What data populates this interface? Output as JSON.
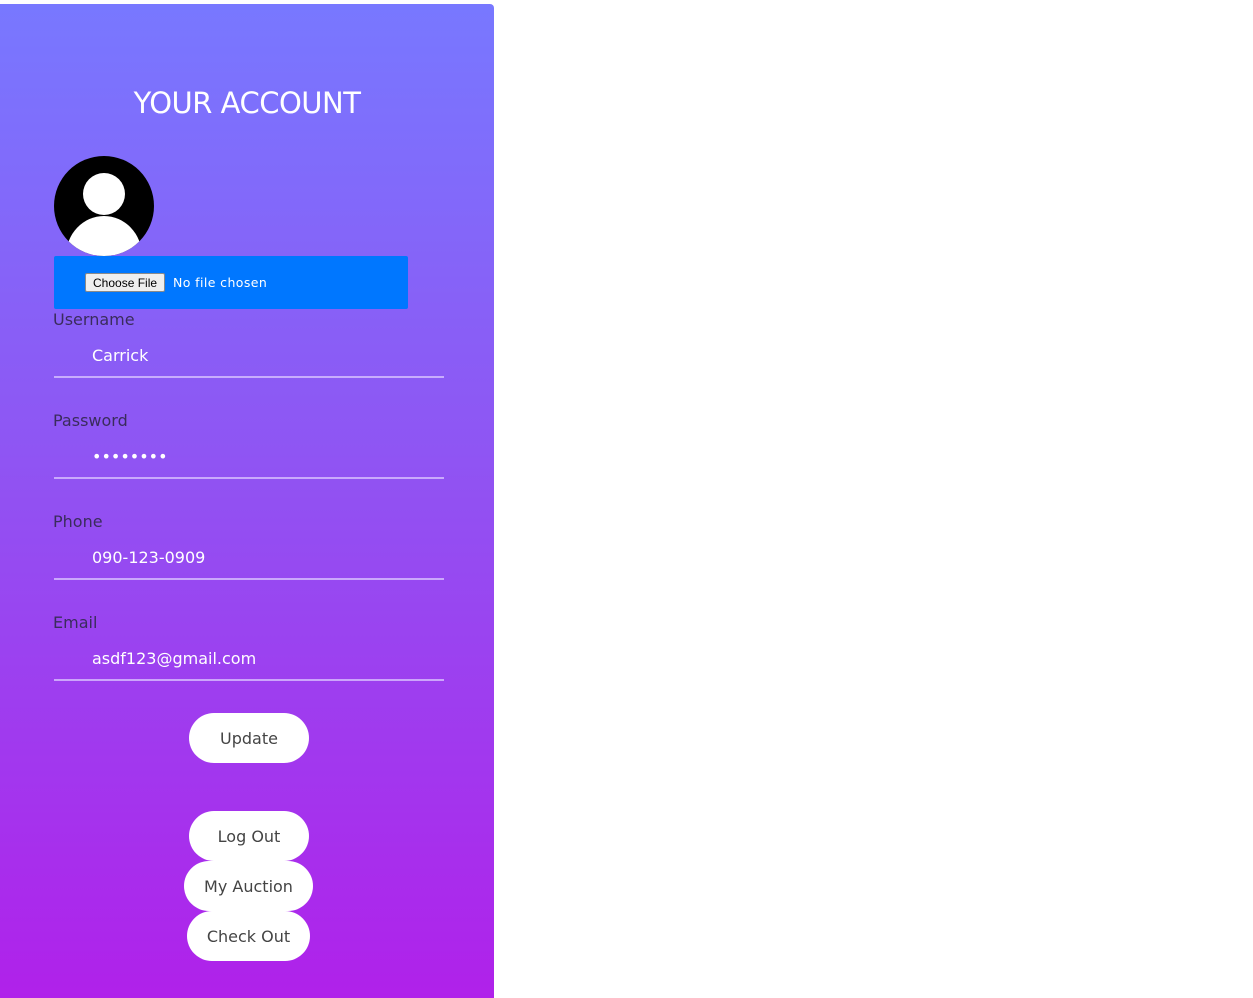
{
  "account": {
    "title": "YOUR ACCOUNT"
  },
  "upload": {
    "button_label": "Choose File",
    "status": "No file chosen"
  },
  "fields": {
    "username": {
      "label": "Username",
      "value": "Carrick"
    },
    "password": {
      "label": "Password",
      "value": "••••••••"
    },
    "phone": {
      "label": "Phone",
      "value": "090-123-0909"
    },
    "email": {
      "label": "Email",
      "value": "asdf123@gmail.com"
    }
  },
  "actions": {
    "update": "Update",
    "logout": "Log Out",
    "my_auction": "My Auction",
    "checkout": "Check Out"
  },
  "colors": {
    "gradient_top": "#7878ff",
    "gradient_bottom": "#b021ea",
    "upload_bar": "#0077ff",
    "button_bg": "#ffffff"
  },
  "icons": {
    "avatar": "user-silhouette-icon"
  }
}
